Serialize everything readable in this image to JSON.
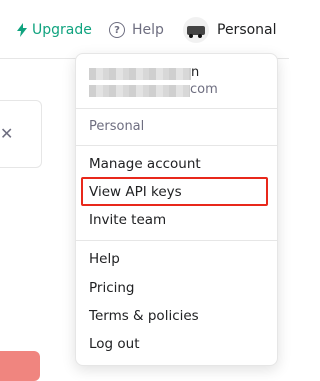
{
  "topbar": {
    "upgrade_label": "Upgrade",
    "help_label": "Help",
    "help_icon_glyph": "?",
    "account_label": "Personal",
    "accent_color": "#10a37f"
  },
  "background": {
    "close_glyph": "✕"
  },
  "menu": {
    "email_tail": "n",
    "email_suffix": "com",
    "section_label": "Personal",
    "group1": [
      "Manage account",
      "View API keys",
      "Invite team"
    ],
    "group2": [
      "Help",
      "Pricing",
      "Terms & policies",
      "Log out"
    ],
    "highlighted_item": "View API keys",
    "highlight_color": "#e8281b"
  }
}
